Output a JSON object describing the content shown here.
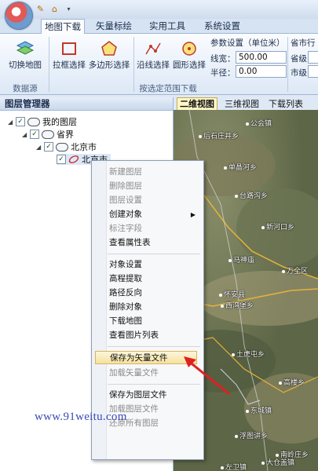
{
  "quick_access": [
    "folder-icon",
    "home-icon",
    "dropdown-icon"
  ],
  "tabs": [
    "地图下载",
    "矢量标绘",
    "实用工具",
    "系统设置"
  ],
  "active_tab": 0,
  "ribbon": {
    "switch_map_label": "切换地图",
    "data_source_group": "数据源",
    "box_select_label": "拉框选择",
    "polygon_select_label": "多边形选择",
    "line_select_label": "沿线选择",
    "circle_select_label": "圆形选择",
    "select_group": "按选定范围下载",
    "params_title": "参数设置（单位米）",
    "line_width_label": "线宽：",
    "line_width_value": "500.00",
    "radius_label": "半径：",
    "radius_value": "0.00",
    "province_header": "省市行",
    "province_label": "省级",
    "city_label": "市级"
  },
  "layer_manager": {
    "title": "图层管理器",
    "nodes": [
      "我的图层",
      "省界",
      "北京市",
      "北京市"
    ]
  },
  "map_tabs": [
    "二维视图",
    "三维视图",
    "下载列表"
  ],
  "map_places": [
    "后石庄井乡",
    "公会镇",
    "单晶河乡",
    "台路沟乡",
    "新河口乡",
    "马神庙",
    "万全区",
    "怀安县",
    "西湾堡乡",
    "土虎屯乡",
    "高楼乡",
    "东城镇",
    "浮图讲乡",
    "南岭庄乡",
    "大仓盖镇",
    "左卫镇"
  ],
  "context_menu": {
    "items": [
      {
        "label": "新建图层",
        "disabled": true
      },
      {
        "label": "删除图层",
        "disabled": true
      },
      {
        "label": "图层设置",
        "disabled": true
      },
      {
        "label": "创建对象",
        "disabled": false,
        "submenu": true
      },
      {
        "label": "标注字段",
        "disabled": true
      },
      {
        "label": "查看属性表",
        "disabled": false
      },
      {
        "label": "对象设置",
        "disabled": false
      },
      {
        "label": "高程提取",
        "disabled": false
      },
      {
        "label": "路径反向",
        "disabled": false
      },
      {
        "label": "删除对象",
        "disabled": false
      },
      {
        "label": "下载地图",
        "disabled": false
      },
      {
        "label": "查看图片列表",
        "disabled": false
      },
      {
        "label": "保存为矢量文件",
        "disabled": false,
        "highlighted": true
      },
      {
        "label": "加载矢量文件",
        "disabled": true
      },
      {
        "label": "保存为图层文件",
        "disabled": false
      },
      {
        "label": "加载图层文件",
        "disabled": true
      },
      {
        "label": "还原所有图层",
        "disabled": true
      }
    ]
  },
  "watermark": "www.91weitu.com",
  "colors": {
    "annotation_arrow": "#e02020",
    "highlight": "#f5e1a0",
    "ribbon_bg": "#dde8f6"
  }
}
